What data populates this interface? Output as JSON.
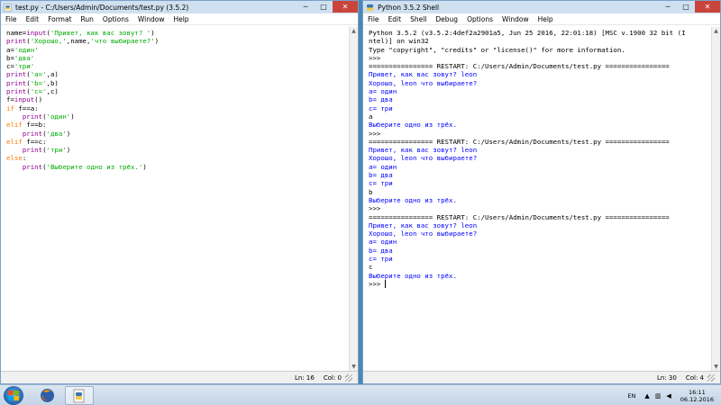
{
  "editor": {
    "title": "test.py - C:/Users/Admin/Documents/test.py (3.5.2)",
    "menus": [
      "File",
      "Edit",
      "Format",
      "Run",
      "Options",
      "Window",
      "Help"
    ],
    "status": {
      "line": "Ln: 16",
      "col": "Col: 0"
    },
    "code_lines": [
      "name=input('Привет, как вас зовут? ')",
      "print('Хорошо,',name,'что выбираете?')",
      "a='один'",
      "b='два'",
      "c='три'",
      "print('a=',a)",
      "print('b=',b)",
      "print('c=',c)",
      "f=input()",
      "if f==a:",
      "    print('один')",
      "elif f==b:",
      "    print('два')",
      "elif f==c:",
      "    print('три')",
      "else:",
      "    print('Выберите одно из трёх.')"
    ]
  },
  "shell": {
    "title": "Python 3.5.2 Shell",
    "menus": [
      "File",
      "Edit",
      "Shell",
      "Debug",
      "Options",
      "Window",
      "Help"
    ],
    "status": {
      "line": "Ln: 30",
      "col": "Col: 4"
    },
    "lines": [
      {
        "t": "Python 3.5.2 (v3.5.2:4def2a2901a5, Jun 25 2016, 22:01:18) [MSC v.1900 32 bit (I",
        "c": "rs"
      },
      {
        "t": "ntel)] on win32",
        "c": "rs"
      },
      {
        "t": "Type \"copyright\", \"credits\" or \"license()\" for more information.",
        "c": "rs"
      },
      {
        "t": ">>> ",
        "c": "prompt"
      },
      {
        "t": "================ RESTART: C:/Users/Admin/Documents/test.py ================",
        "c": "rs"
      },
      {
        "t": "Привет, как вас зовут? leon",
        "c": "out"
      },
      {
        "t": "Хорошо, leon что выбираете?",
        "c": "out"
      },
      {
        "t": "a= один",
        "c": "out"
      },
      {
        "t": "b= два",
        "c": "out"
      },
      {
        "t": "c= три",
        "c": "out"
      },
      {
        "t": "a",
        "c": "rs"
      },
      {
        "t": "Выберите одно из трёх.",
        "c": "out"
      },
      {
        "t": ">>> ",
        "c": "prompt"
      },
      {
        "t": "================ RESTART: C:/Users/Admin/Documents/test.py ================",
        "c": "rs"
      },
      {
        "t": "Привет, как вас зовут? leon",
        "c": "out"
      },
      {
        "t": "Хорошо, leon что выбираете?",
        "c": "out"
      },
      {
        "t": "a= один",
        "c": "out"
      },
      {
        "t": "b= два",
        "c": "out"
      },
      {
        "t": "c= три",
        "c": "out"
      },
      {
        "t": "b",
        "c": "rs"
      },
      {
        "t": "Выберите одно из трёх.",
        "c": "out"
      },
      {
        "t": ">>> ",
        "c": "prompt"
      },
      {
        "t": "================ RESTART: C:/Users/Admin/Documents/test.py ================",
        "c": "rs"
      },
      {
        "t": "Привет, как вас зовут? leon",
        "c": "out"
      },
      {
        "t": "Хорошо, leon что выбираете?",
        "c": "out"
      },
      {
        "t": "a= один",
        "c": "out"
      },
      {
        "t": "b= два",
        "c": "out"
      },
      {
        "t": "c= три",
        "c": "out"
      },
      {
        "t": "c",
        "c": "rs"
      },
      {
        "t": "Выберите одно из трёх.",
        "c": "out"
      },
      {
        "t": ">>> ",
        "c": "prompt"
      }
    ]
  },
  "taskbar": {
    "language": "EN",
    "time": "16:11",
    "date": "06.12.2016",
    "apps": [
      "start-orb",
      "firefox",
      "python-idle"
    ]
  },
  "colors": {
    "keyword": "#ff7700",
    "builtin": "#900090",
    "string": "#00aa00",
    "output": "#0000ff"
  }
}
